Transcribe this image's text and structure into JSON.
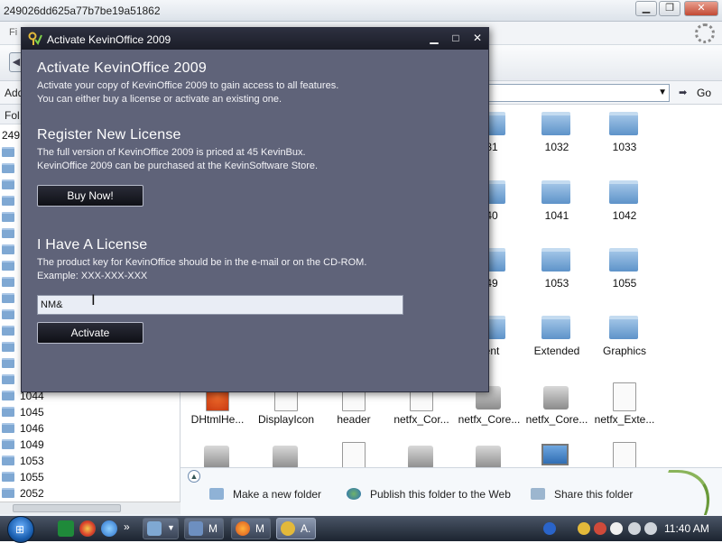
{
  "explorer": {
    "title": "249026dd625a77b7be19a51862",
    "menu_first": "Fi",
    "address_label": "Add",
    "go_label": "Go",
    "folders_header": "Fol",
    "folder_tree_top": "249",
    "folder_tree": [
      "1044",
      "1045",
      "1046",
      "1049",
      "1053",
      "1055",
      "2052"
    ],
    "items": [
      {
        "label": "31",
        "kind": "folder"
      },
      {
        "label": "1032",
        "kind": "folder"
      },
      {
        "label": "1033",
        "kind": "folder"
      },
      {
        "label": "40",
        "kind": "folder"
      },
      {
        "label": "1041",
        "kind": "folder"
      },
      {
        "label": "1042",
        "kind": "folder"
      },
      {
        "label": "49",
        "kind": "folder"
      },
      {
        "label": "1053",
        "kind": "folder"
      },
      {
        "label": "1055",
        "kind": "folder"
      },
      {
        "label": "ent",
        "kind": "folder"
      },
      {
        "label": "Extended",
        "kind": "folder"
      },
      {
        "label": "Graphics",
        "kind": "folder"
      },
      {
        "label": "DHtmlHe...",
        "kind": "file"
      },
      {
        "label": "DisplayIcon",
        "kind": "file"
      },
      {
        "label": "header",
        "kind": "file"
      },
      {
        "label": "netfx_Cor...",
        "kind": "file"
      },
      {
        "label": "netfx_Core...",
        "kind": "drive"
      },
      {
        "label": "netfx_Core...",
        "kind": "drive"
      },
      {
        "label": "netfx_Exte...",
        "kind": "file"
      }
    ],
    "tasks": [
      {
        "label": "Make a new folder"
      },
      {
        "label": "Publish this folder to the Web"
      },
      {
        "label": "Share this folder"
      }
    ]
  },
  "dialog": {
    "title": "Activate KevinOffice 2009",
    "heading": "Activate KevinOffice 2009",
    "intro_1": "Activate your copy of KevinOffice 2009 to gain access to all features.",
    "intro_2": "You can either buy a license or activate an existing one.",
    "register_heading": "Register New License",
    "register_1": "The full version of KevinOffice 2009 is priced at 45 KevinBux.",
    "register_2": "KevinOffice 2009 can be purchased at the KevinSoftware Store.",
    "buy_label": "Buy Now!",
    "license_heading": "I Have A License",
    "license_1": "The product key for KevinOffice should be in the e-mail or on the CD-ROM.",
    "license_2": "Example: XXX-XXX-XXX",
    "key_value": "NM&",
    "activate_label": "Activate"
  },
  "taskbar": {
    "items": [
      {
        "label": "M"
      },
      {
        "label": "M"
      },
      {
        "label": "A."
      }
    ],
    "clock": "11:40 AM",
    "more": "»"
  }
}
